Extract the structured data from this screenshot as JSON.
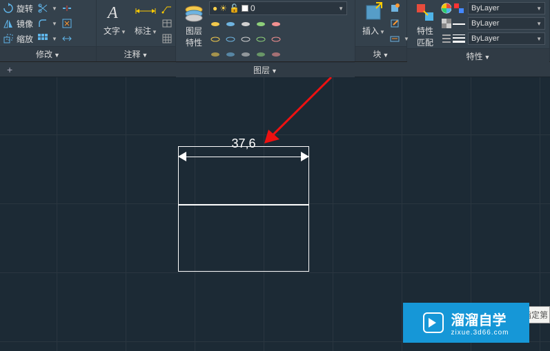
{
  "ribbon": {
    "modify": {
      "rotate": "旋转",
      "mirror": "镜像",
      "scale": "缩放",
      "title": "修改"
    },
    "annotate": {
      "text": "文字",
      "dim": "标注",
      "title": "注释"
    },
    "layer": {
      "btn": "图层\n特性",
      "selector_value": "0",
      "title": "图层"
    },
    "block": {
      "insert": "插入",
      "title": "块"
    },
    "props": {
      "match": "特性\n匹配",
      "color": "ByLayer",
      "linetype": "ByLayer",
      "lineweight": "ByLayer",
      "title": "特性"
    }
  },
  "canvas": {
    "dim_value": "37,6"
  },
  "watermark": {
    "main": "溜溜自学",
    "sub": "zixue.3d66.com"
  },
  "cmd": "或指定第"
}
